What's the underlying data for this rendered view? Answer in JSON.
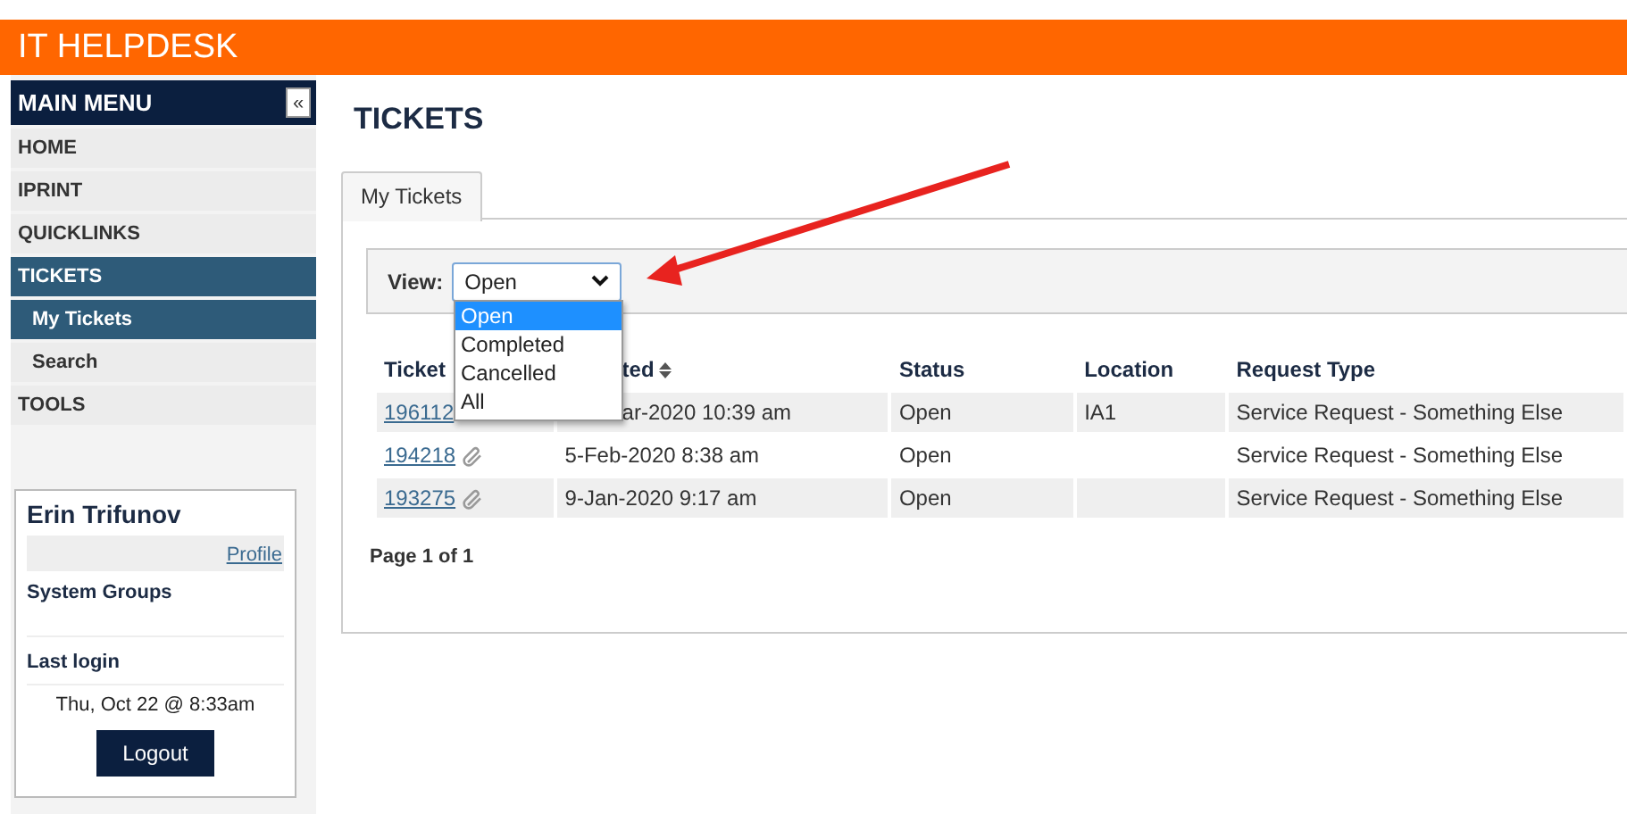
{
  "app": {
    "title": "IT HELPDESK"
  },
  "sidebar": {
    "header": "MAIN MENU",
    "collapse": "«",
    "items": [
      {
        "label": "HOME",
        "selected": false
      },
      {
        "label": "IPRINT",
        "selected": false
      },
      {
        "label": "QUICKLINKS",
        "selected": false
      },
      {
        "label": "TICKETS",
        "selected": true,
        "children": [
          {
            "label": "My Tickets",
            "selected": true
          },
          {
            "label": "Search",
            "selected": false
          }
        ]
      },
      {
        "label": "TOOLS",
        "selected": false
      }
    ]
  },
  "user": {
    "name": "Erin Trifunov",
    "profile_link": "Profile",
    "groups": "System Groups",
    "last_login_label": "Last login",
    "last_login": "Thu, Oct 22 @ 8:33am",
    "logout": "Logout"
  },
  "page": {
    "title": "TICKETS",
    "tabs": [
      {
        "label": "My Tickets",
        "selected": true
      }
    ],
    "view": {
      "label": "View:",
      "value": "Open",
      "expanded": true,
      "options": [
        {
          "label": "Open",
          "selected": true
        },
        {
          "label": "Completed",
          "selected": false
        },
        {
          "label": "Cancelled",
          "selected": false
        },
        {
          "label": "All",
          "selected": false
        }
      ]
    },
    "table": {
      "columns": [
        {
          "label": "Ticket",
          "sortable": false
        },
        {
          "label": "ted",
          "sortable": true
        },
        {
          "label": "Status",
          "sortable": false
        },
        {
          "label": "Location",
          "sortable": false
        },
        {
          "label": "Request Type",
          "sortable": false
        }
      ],
      "rows": [
        {
          "ticket": "196112",
          "attachment": false,
          "created": "ar-2020 10:39 am",
          "status": "Open",
          "location": "IA1",
          "request_type": "Service Request - Something Else"
        },
        {
          "ticket": "194218",
          "attachment": true,
          "created": "5-Feb-2020 8:38 am",
          "status": "Open",
          "request_type": "Service Request - Something Else"
        },
        {
          "ticket": "193275",
          "attachment": true,
          "created": "9-Jan-2020 9:17 am",
          "status": "Open",
          "request_type": "Service Request - Something Else"
        }
      ]
    },
    "pager": "Page 1 of 1"
  }
}
